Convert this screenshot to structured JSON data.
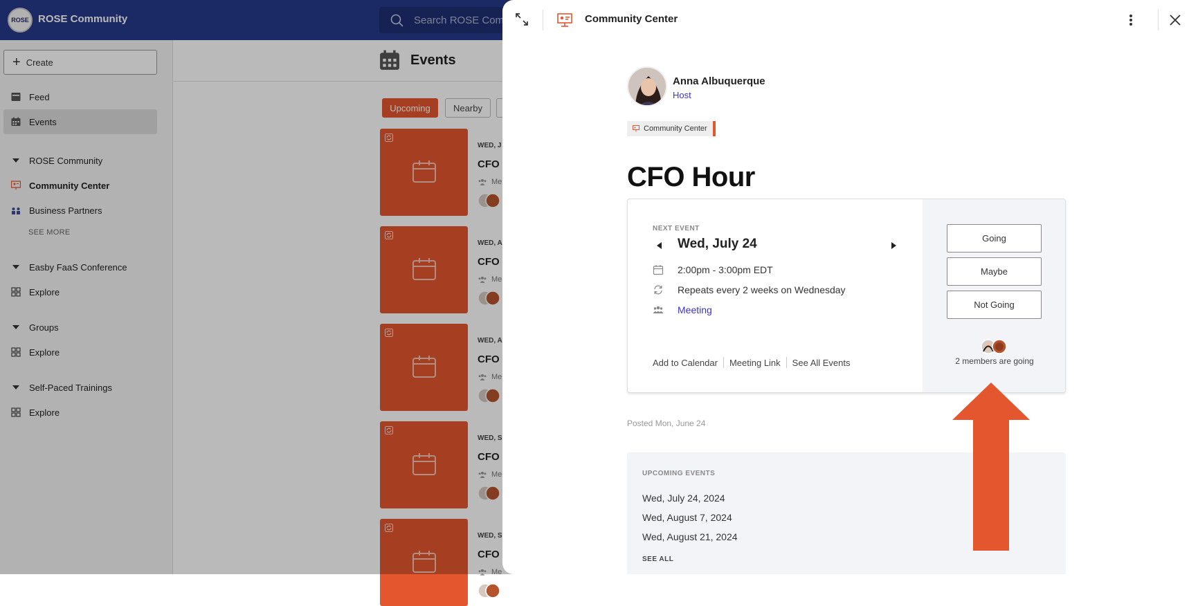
{
  "app": {
    "title": "ROSE Community",
    "logo_text": "ROSE",
    "search_placeholder": "Search ROSE Community"
  },
  "sidebar": {
    "create_label": "Create",
    "items": [
      {
        "label": "Feed",
        "icon": "feed-icon"
      },
      {
        "label": "Events",
        "icon": "calendar-icon",
        "active": true
      }
    ],
    "sections": [
      {
        "label": "ROSE Community",
        "items": [
          {
            "label": "Community Center",
            "icon": "presentation-icon",
            "bold": true
          },
          {
            "label": "Business Partners",
            "icon": "group-icon"
          }
        ],
        "see_more": "SEE MORE"
      },
      {
        "label": "Easby FaaS Conference",
        "items": [
          {
            "label": "Explore",
            "icon": "grid-icon"
          }
        ]
      },
      {
        "label": "Groups",
        "items": [
          {
            "label": "Explore",
            "icon": "grid-icon"
          }
        ]
      },
      {
        "label": "Self-Paced Trainings",
        "items": [
          {
            "label": "Explore",
            "icon": "grid-icon"
          }
        ]
      }
    ]
  },
  "main": {
    "title": "Events",
    "filters": [
      {
        "label": "Upcoming",
        "active": true
      },
      {
        "label": "Nearby",
        "active": false
      }
    ],
    "cards": [
      {
        "date": "WED, J",
        "name": "CFO H",
        "meeting": "Me"
      },
      {
        "date": "WED, A",
        "name": "CFO H",
        "meeting": "Me"
      },
      {
        "date": "WED, A",
        "name": "CFO H",
        "meeting": "Me"
      },
      {
        "date": "WED, S",
        "name": "CFO H",
        "meeting": "Me"
      },
      {
        "date": "WED, S",
        "name": "CFO H",
        "meeting": "Me"
      }
    ]
  },
  "panel": {
    "header_title": "Community Center",
    "host": {
      "name": "Anna Albuquerque",
      "role": "Host"
    },
    "tag": "Community Center",
    "event_title": "CFO Hour",
    "next_event_label": "NEXT EVENT",
    "next_date": "Wed, July 24",
    "time": "2:00pm - 3:00pm EDT",
    "repeats": "Repeats every 2 weeks on Wednesday",
    "meeting": "Meeting",
    "links": {
      "add_to_calendar": "Add to Calendar",
      "meeting_link": "Meeting Link",
      "see_all_events": "See All Events"
    },
    "rsvp": {
      "going": "Going",
      "maybe": "Maybe",
      "not_going": "Not Going"
    },
    "going_text": "2 members are going",
    "posted": "Posted Mon, June 24",
    "upcoming": {
      "label": "UPCOMING EVENTS",
      "dates": [
        "Wed, July 24, 2024",
        "Wed, August 7, 2024",
        "Wed, August 21, 2024"
      ],
      "see_all": "SEE ALL"
    }
  },
  "colors": {
    "topbar": "#263a8a",
    "accent": "#e4572e",
    "link": "#3a33c9"
  }
}
